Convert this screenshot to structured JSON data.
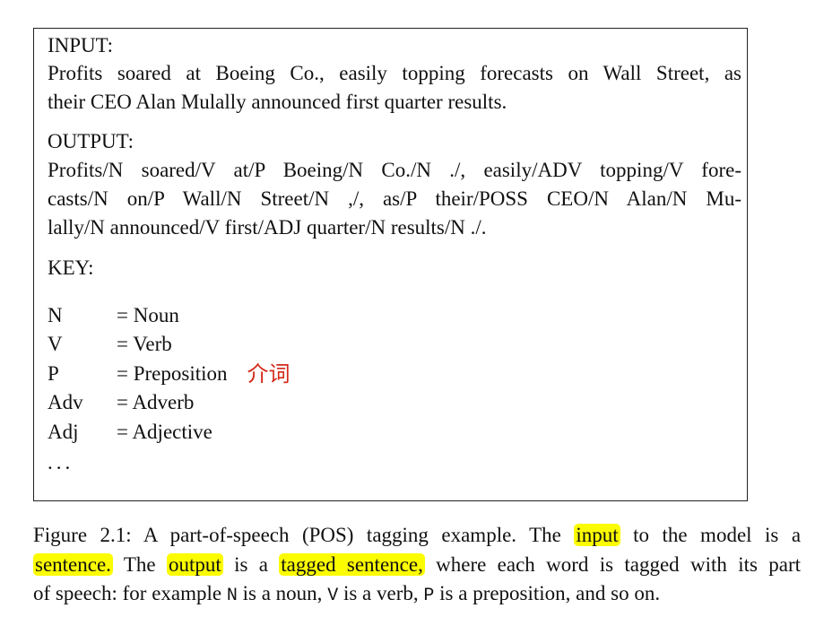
{
  "figure": {
    "input_heading": "INPUT:",
    "input_lines": [
      "Profits soared at Boeing Co., easily topping forecasts on Wall Street, as",
      "their CEO Alan Mulally announced first quarter results."
    ],
    "output_heading": "OUTPUT:",
    "output_lines": [
      "Profits/N soared/V at/P Boeing/N Co./N ./, easily/ADV topping/V fore-",
      "casts/N on/P Wall/N Street/N ,/, as/P their/POSS CEO/N Alan/N Mu-",
      "lally/N announced/V first/ADJ quarter/N results/N ./."
    ],
    "key_heading": "KEY:",
    "key": [
      {
        "abbr": "N",
        "def": "= Noun"
      },
      {
        "abbr": "V",
        "def": "= Verb"
      },
      {
        "abbr": "P",
        "def": "= Preposition"
      },
      {
        "abbr": "Adv",
        "def": "= Adverb"
      },
      {
        "abbr": "Adj",
        "def": "= Adjective"
      }
    ],
    "ellipsis": "...",
    "annotation": "介词"
  },
  "caption": {
    "line1_pre": "Figure 2.1: A part-of-speech (POS) tagging example. The",
    "line1_hl": "input",
    "line1_post": "to the model is a",
    "line2_hl1": "sentence.",
    "line2_mid1": "The",
    "line2_hl2": "output",
    "line2_mid2": "is a",
    "line2_hl3": "tagged sentence,",
    "line2_post": "where each word is tagged with its part",
    "line3_a": "of speech: for example",
    "line3_n": "N",
    "line3_b": "is a noun,",
    "line3_v": "V",
    "line3_c": "is a verb,",
    "line3_p": "P",
    "line3_d": "is a preposition, and so on."
  },
  "colors": {
    "highlight": "#fcfc00",
    "annotation": "#d42a1a"
  }
}
